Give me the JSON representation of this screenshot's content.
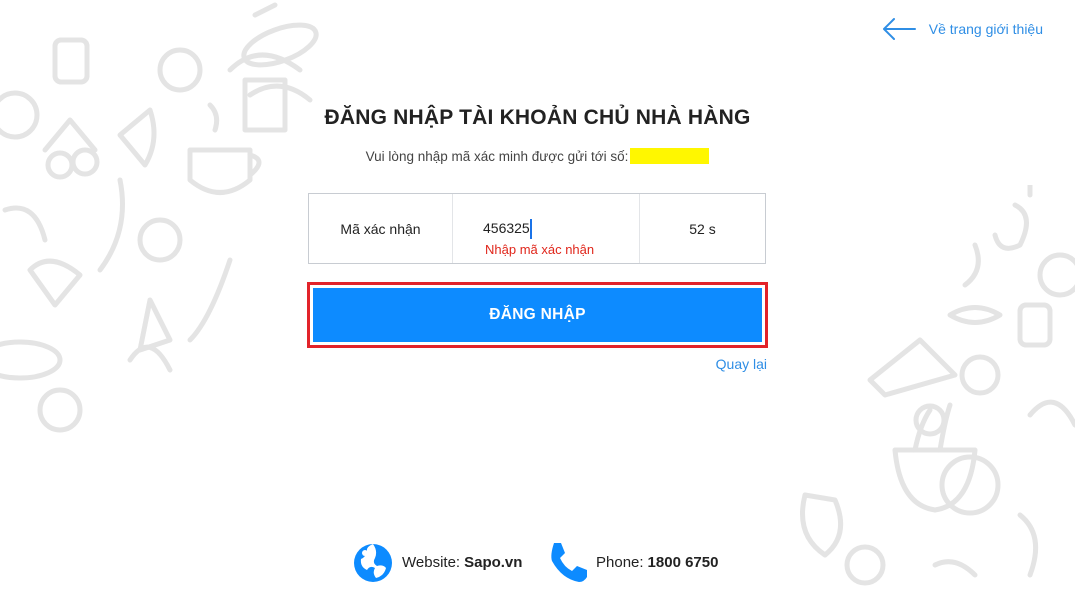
{
  "header": {
    "back_home_label": "Về trang giới thiệu",
    "back_icon": "arrow-left-icon"
  },
  "login": {
    "title": "ĐĂNG NHẬP TÀI KHOẢN CHỦ NHÀ HÀNG",
    "subtitle": "Vui lòng nhập mã xác minh được gửi tới số:",
    "otp_label": "Mã xác nhận",
    "otp_value": "456325",
    "otp_error": "Nhập mã xác nhận",
    "countdown": "52 s",
    "submit_label": "ĐĂNG NHẬP",
    "back_label": "Quay lại"
  },
  "footer": {
    "website_label": "Website:",
    "website_value": "Sapo.vn",
    "phone_label": "Phone:",
    "phone_value": "1800 6750",
    "website_icon": "globe-icon",
    "phone_icon": "phone-icon"
  },
  "colors": {
    "accent": "#0d8bff",
    "link": "#2f8ee5",
    "error": "#e0261b",
    "highlight_frame": "#e2232a",
    "masked_phone": "#fff700"
  }
}
